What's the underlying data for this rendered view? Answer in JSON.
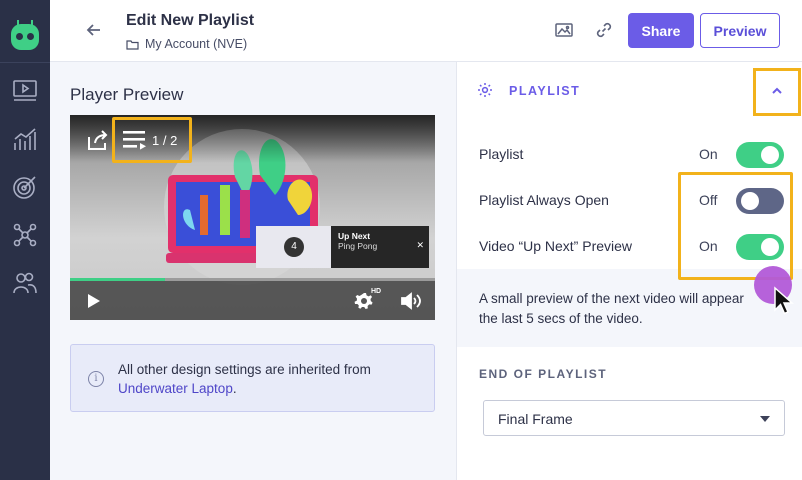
{
  "header": {
    "title": "Edit New Playlist",
    "breadcrumb": "My Account (NVE)",
    "share_label": "Share",
    "preview_label": "Preview",
    "icons": [
      "back-arrow-icon",
      "folder-icon",
      "image-icon",
      "link-icon"
    ]
  },
  "rail": {
    "icons": [
      "logo-icon",
      "video-icon",
      "analytics-icon",
      "target-icon",
      "network-icon",
      "users-icon"
    ]
  },
  "player_preview": {
    "title": "Player Preview",
    "playlist_count": "1 / 2",
    "up_next_label": "Up Next",
    "up_next_title": "Ping Pong",
    "up_next_number": "4",
    "progress": 0.26,
    "hd_label": "HD"
  },
  "info": {
    "text": "All other design settings are inherited from",
    "link": "Underwater Laptop",
    "suffix": "."
  },
  "panel": {
    "section_title": "PLAYLIST",
    "rows": [
      {
        "label": "Playlist",
        "state": "On",
        "on": true
      },
      {
        "label": "Playlist Always Open",
        "state": "Off",
        "on": false
      },
      {
        "label": "Video “Up Next” Preview",
        "state": "On",
        "on": true
      }
    ],
    "description_line1": "A small preview of the next video will appear",
    "description_line2": "the last 5 secs of the video.",
    "end_title": "END OF PLAYLIST",
    "end_value": "Final Frame"
  },
  "colors": {
    "accent": "#6b5ce7",
    "toggle_on": "#3fcf86",
    "toggle_off": "#5e6687",
    "highlight": "#f2b21b"
  }
}
